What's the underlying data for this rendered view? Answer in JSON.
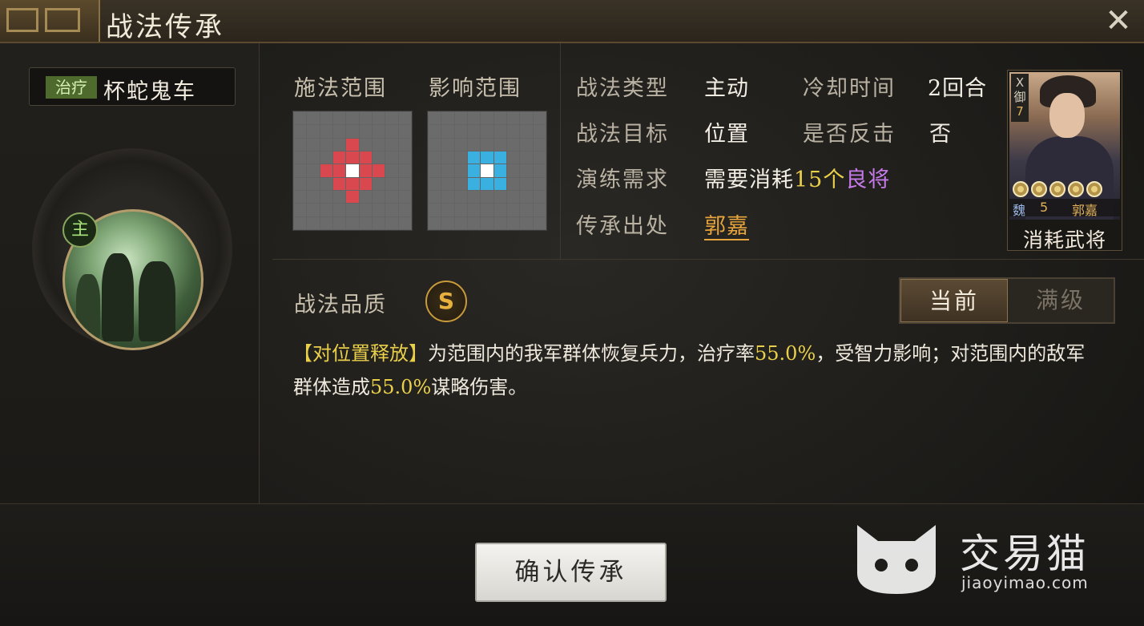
{
  "window": {
    "title": "战法传承",
    "close_label": "✕"
  },
  "skill": {
    "tag": "治疗",
    "name": "杯蛇鬼车",
    "emblem_badge": "主"
  },
  "ranges": {
    "cast_label": "施法范围",
    "effect_label": "影响范围"
  },
  "info": {
    "type_label": "战法类型",
    "type_value": "主动",
    "cooldown_label": "冷却时间",
    "cooldown_value": "2回合",
    "target_label": "战法目标",
    "target_value": "位置",
    "counter_label": "是否反击",
    "counter_value": "否",
    "practice_label": "演练需求",
    "practice_prefix": "需要消耗",
    "practice_count": "15个",
    "practice_item": "良将",
    "source_label": "传承出处",
    "source_value": "郭嘉"
  },
  "general_card": {
    "type_glyph": "X",
    "type_text": "御",
    "cost": "7",
    "faction": "魏",
    "level": "5",
    "name": "郭嘉",
    "stars": 5,
    "caption": "消耗武将"
  },
  "quality": {
    "label": "战法品质",
    "grade": "S"
  },
  "toggle": {
    "current": "当前",
    "max": "满级"
  },
  "description": {
    "bracket": "【对位置释放】",
    "part1": "为范围内的我军群体恢复兵力，治疗率",
    "rate1": "55.0%",
    "part2": "，受智力影响；对范围内的敌军群体造成",
    "rate2": "55.0%",
    "part3": "谋略伤害。"
  },
  "actions": {
    "confirm": "确认传承"
  },
  "watermark": {
    "brand": "交易猫",
    "url": "jiaoyimao.com"
  },
  "colors": {
    "accent_gold": "#e9cf4a",
    "purple": "#c57ae8",
    "orange": "#e7a43c",
    "cast_red": "#d9484f",
    "effect_blue": "#3ab0e0",
    "heal_green": "#4e6a2c"
  }
}
